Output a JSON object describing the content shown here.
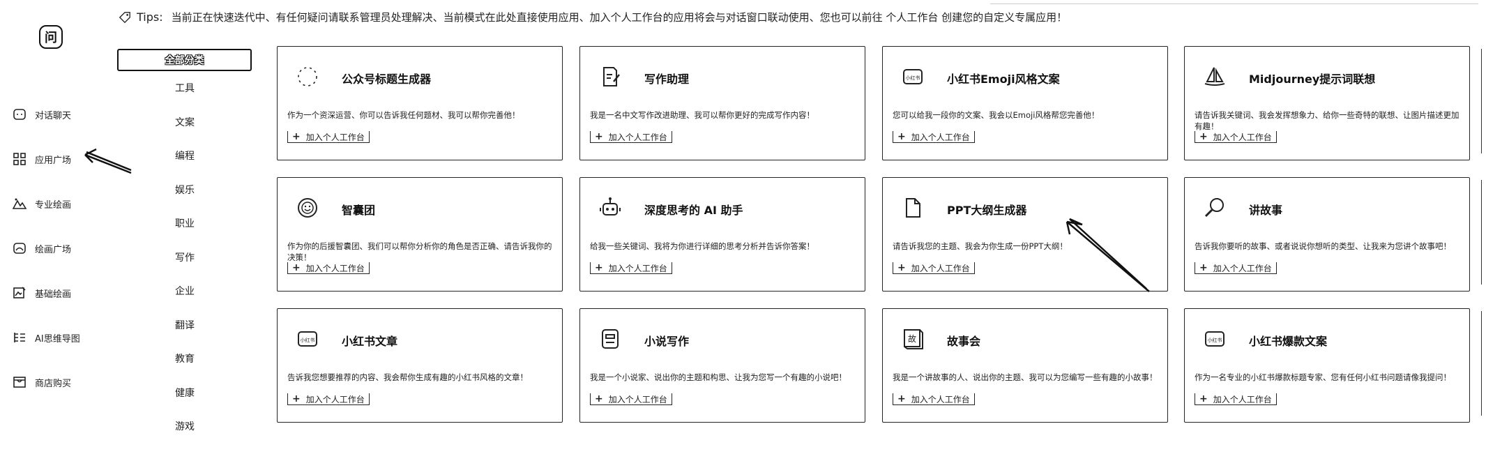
{
  "tips": {
    "label": "Tips:",
    "text": "当前正在快速迭代中、有任何疑问请联系管理员处理解决、当前模式在此处直接使用应用、加入个人工作台的应用将会与对话窗口联动使用、您也可以前往 个人工作台 创建您的自定义专属应用！"
  },
  "logo": {
    "glyph": "问"
  },
  "nav": [
    {
      "label": "对话聊天",
      "icon": "chat-icon"
    },
    {
      "label": "应用广场",
      "icon": "grid-icon"
    },
    {
      "label": "专业绘画",
      "icon": "mountain-icon"
    },
    {
      "label": "绘画广场",
      "icon": "gallery-icon"
    },
    {
      "label": "基础绘画",
      "icon": "image-edit-icon"
    },
    {
      "label": "AI思维导图",
      "icon": "mindmap-icon"
    },
    {
      "label": "商店购买",
      "icon": "shop-icon"
    }
  ],
  "categories": {
    "active": "全部分类",
    "items": [
      "工具",
      "文案",
      "编程",
      "娱乐",
      "职业",
      "写作",
      "企业",
      "翻译",
      "教育",
      "健康",
      "游戏"
    ]
  },
  "add_label": "加入个人工作台",
  "cards": [
    {
      "title": "公众号标题生成器",
      "desc": "作为一个资深运营、你可以告诉我任何题材、我可以帮你完善他！",
      "icon": "dotted-circle-icon"
    },
    {
      "title": "写作助理",
      "desc": "我是一名中文写作改进助理、我可以帮你更好的完成写作内容！",
      "icon": "pen-doc-icon"
    },
    {
      "title": "小红书Emoji风格文案",
      "desc": "您可以给我一段你的文案、我会以Emoji风格帮您完善他！",
      "icon": "xiaohongshu-icon",
      "icon_text": "小红书"
    },
    {
      "title": "Midjourney提示词联想",
      "desc": "请告诉我关键词、我会发挥想象力、给你一些奇特的联想、让图片描述更加有趣！",
      "icon": "sailboat-icon"
    },
    {
      "title": "智囊团",
      "desc": "作为你的后援智囊团、我们可以帮你分析你的角色是否正确、请告诉我你的决策！",
      "icon": "smile-icon"
    },
    {
      "title": "深度思考的 AI 助手",
      "desc": "给我一些关键词、我将为你进行详细的思考分析并告诉你答案！",
      "icon": "robot-icon"
    },
    {
      "title": "PPT大纲生成器",
      "desc": "请告诉我您的主题、我会为你生成一份PPT大纲！",
      "icon": "file-icon"
    },
    {
      "title": "讲故事",
      "desc": "告诉我你要听的故事、或者说说你想听的类型、让我来为您讲个故事吧！",
      "icon": "magnifier-icon"
    },
    {
      "title": "小红书文章",
      "desc": "告诉我您想要推荐的内容、我会帮你生成有趣的小红书风格的文章！",
      "icon": "xiaohongshu-icon",
      "icon_text": "小红书"
    },
    {
      "title": "小说写作",
      "desc": "我是一个小说家、说出你的主题和构思、让我为您写一个有趣的小说吧！",
      "icon": "novel-doc-icon"
    },
    {
      "title": "故事会",
      "desc": "我是一个讲故事的人、说出你的主题、我可以为您编写一些有趣的小故事！",
      "icon": "story-book-icon",
      "icon_text": "故"
    },
    {
      "title": "小红书爆款文案",
      "desc": "作为一名专业的小红书爆款标题专家、您有任何小红书问题请像我提问！",
      "icon": "xiaohongshu-icon",
      "icon_text": "小红书"
    }
  ]
}
